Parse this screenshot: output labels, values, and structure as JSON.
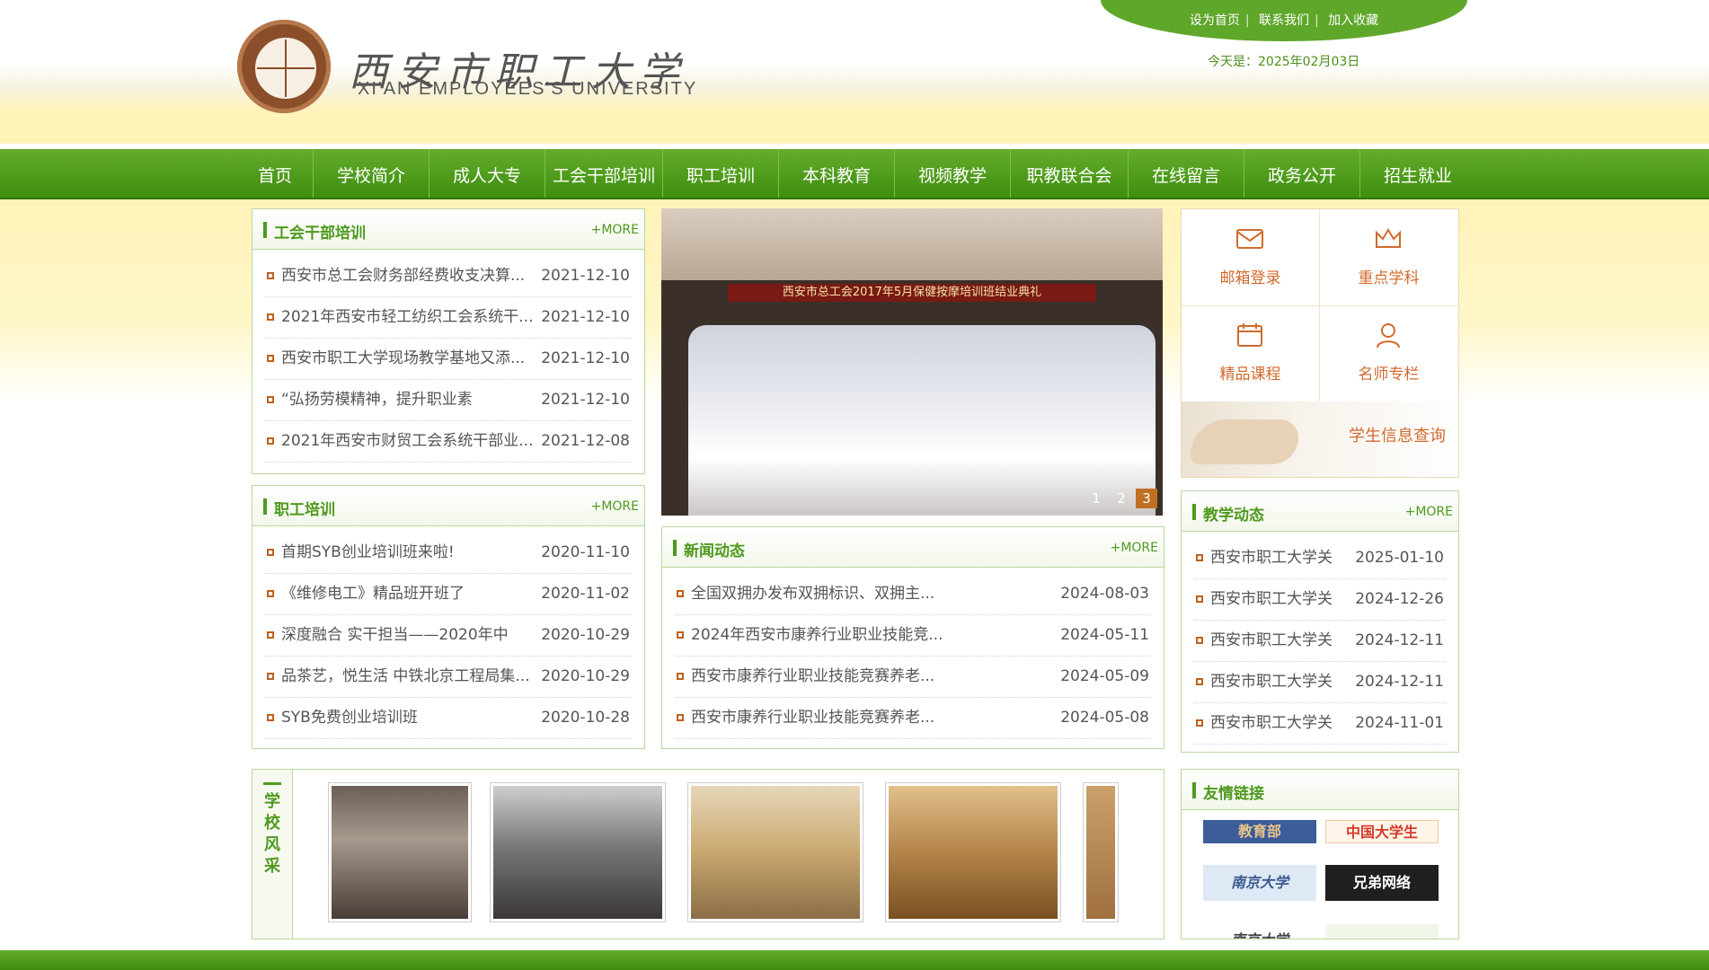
{
  "header": {
    "logo_cn": "西安市职工大学",
    "logo_en": "XI'AN EMPLOYEES'S UNIVERSITY",
    "top_links": [
      "设为首页",
      "联系我们",
      "加入收藏"
    ],
    "today_label": "今天是：2025年02月03日"
  },
  "nav": [
    "首页",
    "学校简介",
    "成人大专",
    "工会干部培训",
    "职工培训",
    "本科教育",
    "视频教学",
    "职教联合会",
    "在线留言",
    "政务公开",
    "招生就业"
  ],
  "panels": {
    "union_training": {
      "title": "工会干部培训",
      "more": "+MORE",
      "items": [
        {
          "title": "西安市总工会财务部经费收支决算...",
          "date": "2021-12-10"
        },
        {
          "title": "2021年西安市轻工纺织工会系统干...",
          "date": "2021-12-10"
        },
        {
          "title": "西安市职工大学现场教学基地又添...",
          "date": "2021-12-10"
        },
        {
          "title": "“弘扬劳模精神，提升职业素",
          "date": "2021-12-10"
        },
        {
          "title": "2021年西安市财贸工会系统干部业...",
          "date": "2021-12-08"
        }
      ]
    },
    "staff_training": {
      "title": "职工培训",
      "more": "+MORE",
      "items": [
        {
          "title": "首期SYB创业培训班来啦!",
          "date": "2020-11-10"
        },
        {
          "title": "《维修电工》精品班开班了",
          "date": "2020-11-02"
        },
        {
          "title": "深度融合 实干担当——2020年中",
          "date": "2020-10-29"
        },
        {
          "title": "品茶艺，悦生活 中铁北京工程局集...",
          "date": "2020-10-29"
        },
        {
          "title": "SYB免费创业培训班",
          "date": "2020-10-28"
        }
      ]
    },
    "news": {
      "title": "新闻动态",
      "more": "+MORE",
      "items": [
        {
          "title": "全国双拥办发布双拥标识、双拥主...",
          "date": "2024-08-03"
        },
        {
          "title": "2024年西安市康养行业职业技能竞...",
          "date": "2024-05-11"
        },
        {
          "title": "西安市康养行业职业技能竞赛养老...",
          "date": "2024-05-09"
        },
        {
          "title": "西安市康养行业职业技能竞赛养老...",
          "date": "2024-05-08"
        }
      ]
    },
    "teaching": {
      "title": "教学动态",
      "more": "+MORE",
      "items": [
        {
          "title": "西安市职工大学关",
          "date": "2025-01-10"
        },
        {
          "title": "西安市职工大学关",
          "date": "2024-12-26"
        },
        {
          "title": "西安市职工大学关",
          "date": "2024-12-11"
        },
        {
          "title": "西安市职工大学关",
          "date": "2024-12-11"
        },
        {
          "title": "西安市职工大学关",
          "date": "2024-11-01"
        }
      ]
    },
    "links": {
      "title": "友情链接"
    }
  },
  "slider": {
    "banner": "西安市总工会2017年5月保健按摩培训班结业典礼",
    "pages": [
      "1",
      "2",
      "3"
    ],
    "active_page": "3"
  },
  "quick": {
    "mail": "邮箱登录",
    "key_subjects": "重点学科",
    "courses": "精品课程",
    "teachers": "名师专栏",
    "student": "学生信息查询"
  },
  "gallery": {
    "label": "学校风采"
  },
  "friend_links": [
    "教育部",
    "中国大学生",
    "南京大学",
    "兄弟网络",
    "南京大学"
  ],
  "colors": {
    "brand_green": "#4e9a1f",
    "accent_orange": "#d26a2d",
    "header_yellow": "#fff3b8"
  }
}
